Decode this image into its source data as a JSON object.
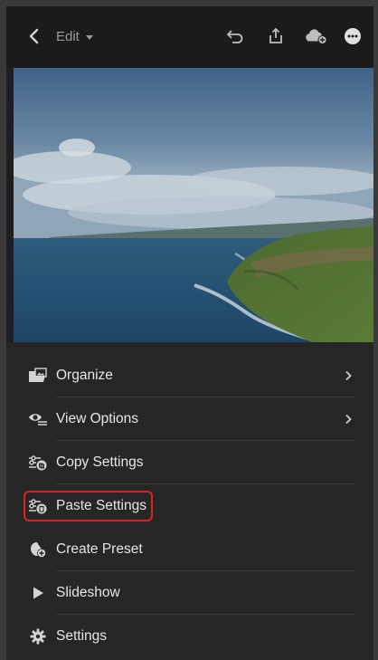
{
  "header": {
    "back_icon": "chevron-left-icon",
    "mode_label": "Edit",
    "mode_caret_icon": "caret-down-icon",
    "actions": [
      {
        "name": "undo-icon"
      },
      {
        "name": "share-icon"
      },
      {
        "name": "cloud-add-icon"
      },
      {
        "name": "more-icon"
      }
    ]
  },
  "menu": {
    "items": [
      {
        "label": "Organize",
        "icon": "folder-image-icon",
        "has_submenu": true
      },
      {
        "label": "View Options",
        "icon": "view-options-icon",
        "has_submenu": true
      },
      {
        "label": "Copy Settings",
        "icon": "copy-settings-icon",
        "has_submenu": false
      },
      {
        "label": "Paste Settings",
        "icon": "paste-settings-icon",
        "has_submenu": false,
        "highlighted": true
      },
      {
        "label": "Create Preset",
        "icon": "create-preset-icon",
        "has_submenu": false
      },
      {
        "label": "Slideshow",
        "icon": "play-icon",
        "has_submenu": false
      },
      {
        "label": "Settings",
        "icon": "gear-icon",
        "has_submenu": false
      }
    ]
  },
  "colors": {
    "highlight": "#e0201f",
    "menu_bg": "#262626",
    "topbar_bg": "#1b1b1b"
  }
}
